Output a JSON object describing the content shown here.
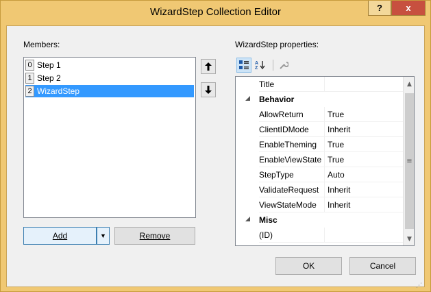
{
  "window": {
    "title": "WizardStep Collection Editor",
    "help_label": "?",
    "close_label": "x"
  },
  "members": {
    "label": "Members:",
    "items": [
      {
        "index": "0",
        "text": "Step 1"
      },
      {
        "index": "1",
        "text": "Step 2"
      },
      {
        "index": "2",
        "text": "WizardStep"
      }
    ],
    "selected_index": 2,
    "move_up_icon": "arrow-up-icon",
    "move_down_icon": "arrow-down-icon"
  },
  "buttons": {
    "add": "Add",
    "remove": "Remove",
    "ok": "OK",
    "cancel": "Cancel"
  },
  "properties": {
    "label": "WizardStep properties:",
    "rows": [
      {
        "type": "prop",
        "name": "Title",
        "value": ""
      },
      {
        "type": "category",
        "name": "Behavior"
      },
      {
        "type": "prop",
        "name": "AllowReturn",
        "value": "True"
      },
      {
        "type": "prop",
        "name": "ClientIDMode",
        "value": "Inherit"
      },
      {
        "type": "prop",
        "name": "EnableTheming",
        "value": "True"
      },
      {
        "type": "prop",
        "name": "EnableViewState",
        "value": "True"
      },
      {
        "type": "prop",
        "name": "StepType",
        "value": "Auto"
      },
      {
        "type": "prop",
        "name": "ValidateRequest",
        "value": "Inherit"
      },
      {
        "type": "prop",
        "name": "ViewStateMode",
        "value": "Inherit"
      },
      {
        "type": "category",
        "name": "Misc"
      },
      {
        "type": "prop",
        "name": "(ID)",
        "value": ""
      }
    ]
  },
  "colors": {
    "titlebar": "#f0c873",
    "close": "#c7503f",
    "selection": "#3399ff"
  }
}
